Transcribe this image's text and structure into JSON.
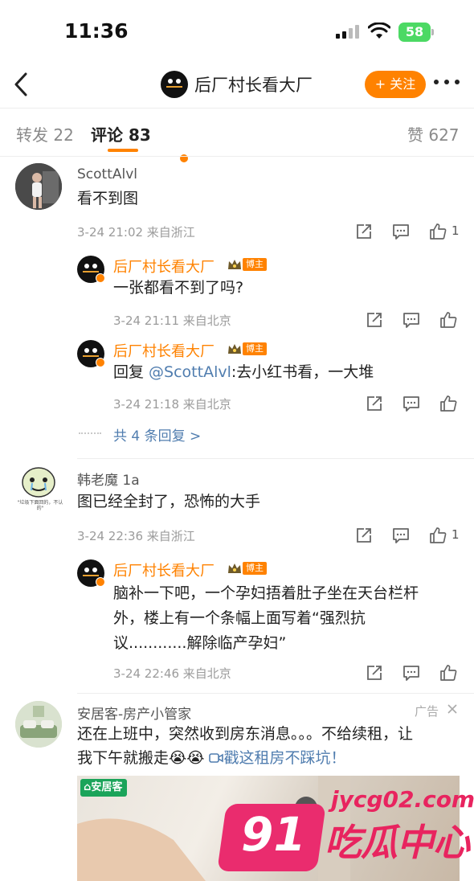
{
  "status_bar": {
    "time": "11:36",
    "battery": "58"
  },
  "nav": {
    "title": "后厂村长看大厂",
    "follow_label": "+ 关注"
  },
  "tabs": {
    "repost": "转发 22",
    "comments": "评论 83",
    "likes": "赞 627"
  },
  "comments": [
    {
      "user": "ScottAlvl",
      "text": "看不到图",
      "meta": "3-24 21:02  来自浙江",
      "likes": "1",
      "replies": [
        {
          "user": "后厂村长看大厂",
          "badge": "博主",
          "text": "一张都看不到了吗?",
          "meta": "3-24 21:11  来自北京"
        },
        {
          "user": "后厂村长看大厂",
          "badge": "博主",
          "text_prefix": "回复 ",
          "mention": "@ScottAlvl",
          "text": ":去小红书看，一大堆",
          "meta": "3-24 21:18  来自北京"
        }
      ],
      "more_replies": "共 4 条回复 >"
    },
    {
      "user": "韩老魔 1a",
      "text": "图已经全封了，恐怖的大手",
      "meta": "3-24 22:36  来自浙江",
      "likes": "1",
      "avatar_caption": "\"垃圾下面回的，不认的\"",
      "replies": [
        {
          "user": "后厂村长看大厂",
          "badge": "博主",
          "text_lines": [
            "脑补一下吧，一个孕妇捂着肚子坐在天台栏杆",
            "外，楼上有一个条幅上面写着“强烈抗",
            "议............解除临产孕妇”"
          ],
          "meta": "3-24 22:46  来自北京"
        }
      ]
    }
  ],
  "ad": {
    "user": "安居客-房产小管家",
    "label": "广告",
    "text_line1": "还在上班中，突然收到房东消息。。。不给续租，让",
    "text_line2": "我下午就搬走",
    "emoji": "😭😭",
    "link": "戳这租房不踩坑！",
    "brand": "安居客"
  },
  "watermark": {
    "number": "91",
    "domain": "jycg02.com",
    "text": "吃瓜中心"
  },
  "colors": {
    "accent": "#ff8200",
    "link": "#507daf",
    "watermark": "#ea2c6e",
    "brand_green": "#1ba45a"
  }
}
